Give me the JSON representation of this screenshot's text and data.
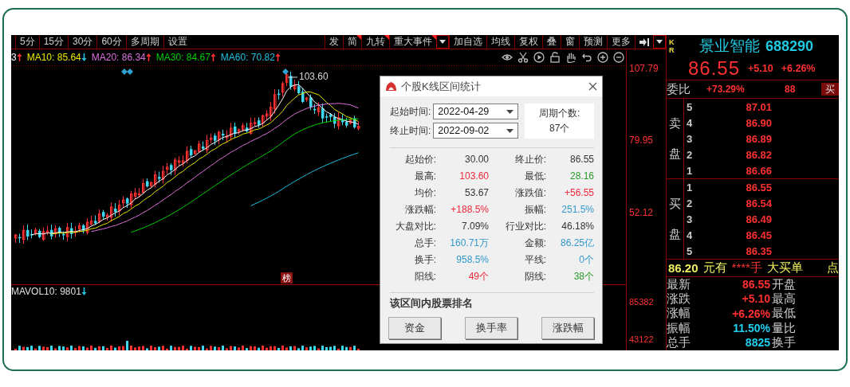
{
  "toolbar": {
    "left": [
      {
        "label": "5分"
      },
      {
        "label": "15分"
      },
      {
        "label": "30分"
      },
      {
        "label": "60分"
      },
      {
        "label": "多周期"
      },
      {
        "label": "设置"
      }
    ],
    "right": [
      {
        "kind": "text",
        "label": "发",
        "flag": false
      },
      {
        "kind": "text",
        "label": "简",
        "flag": true
      },
      {
        "kind": "text",
        "label": "九转",
        "flag": true
      },
      {
        "kind": "text",
        "label": "重大事件",
        "flag": true
      },
      {
        "kind": "dropdown"
      },
      {
        "kind": "text",
        "label": "加自选",
        "flag": false
      },
      {
        "kind": "text",
        "label": "均线",
        "flag": false
      },
      {
        "kind": "text",
        "label": "复权",
        "flag": false
      },
      {
        "kind": "text",
        "label": "叠",
        "flag": false
      },
      {
        "kind": "text",
        "label": "窗",
        "flag": false
      },
      {
        "kind": "text",
        "label": "预测",
        "flag": false
      },
      {
        "kind": "text",
        "label": "更多",
        "flag": false
      },
      {
        "kind": "icon"
      },
      {
        "kind": "dropdown"
      }
    ]
  },
  "chart": {
    "ma": [
      {
        "label": "3",
        "color": "#ffffff",
        "rising": true
      },
      {
        "label": "MA10: 85.64",
        "color": "#e8e800",
        "rising": false
      },
      {
        "label": "MA20: 86.34",
        "color": "#e070e0",
        "rising": true
      },
      {
        "label": "MA30: 84.67",
        "color": "#00d000",
        "rising": true
      },
      {
        "label": "MA60: 70.82",
        "color": "#20c0e0",
        "rising": true
      }
    ],
    "high_label": "103.60",
    "event_badge": "榜",
    "price_axis": [
      "107.79",
      "79.95",
      "52.12"
    ],
    "volume": {
      "label": "MAVOL10: 9801",
      "rising": false,
      "axis": [
        "85382",
        "43122"
      ]
    }
  },
  "dialog": {
    "title": "个股K线区间统计",
    "start": {
      "label": "起始时间:",
      "value": "2022-04-29"
    },
    "end": {
      "label": "终止时间:",
      "value": "2022-09-02"
    },
    "period": {
      "label": "周期个数:",
      "value": "87个"
    },
    "stats": [
      {
        "label": "起始价:",
        "value": "30.00",
        "color": "#333333"
      },
      {
        "label": "终止价:",
        "value": "86.55",
        "color": "#333333"
      },
      {
        "label": "最高:",
        "value": "103.60",
        "color": "#f0283c"
      },
      {
        "label": "最低:",
        "value": "28.16",
        "color": "#2a9a2a"
      },
      {
        "label": "均价:",
        "value": "53.67",
        "color": "#333333"
      },
      {
        "label": "涨跌值:",
        "value": "+56.55",
        "color": "#f0283c"
      },
      {
        "label": "涨跌幅:",
        "value": "+188.5%",
        "color": "#f0283c"
      },
      {
        "label": "振幅:",
        "value": "251.5%",
        "color": "#3399cc"
      },
      {
        "label": "大盘对比:",
        "value": "7.09%",
        "color": "#333333"
      },
      {
        "label": "行业对比:",
        "value": "46.18%",
        "color": "#333333"
      },
      {
        "label": "总手:",
        "value": "160.71万",
        "color": "#3399cc"
      },
      {
        "label": "金额:",
        "value": "86.25亿",
        "color": "#3399cc"
      },
      {
        "label": "换手:",
        "value": "958.5%",
        "color": "#3399cc"
      },
      {
        "label": "平线:",
        "value": "0个",
        "color": "#3399cc"
      },
      {
        "label": "阳线:",
        "value": "49个",
        "color": "#f0283c"
      },
      {
        "label": "阴线:",
        "value": "38个",
        "color": "#2a9a2a"
      }
    ],
    "ranking_title": "该区间内股票排名",
    "buttons": [
      "资金",
      "换手率",
      "涨跌幅"
    ]
  },
  "quote": {
    "badge": [
      "K",
      "R"
    ],
    "name": "景业智能",
    "code": "688290",
    "price": "86.55",
    "change": "+5.10",
    "change_pct": "+6.26%",
    "ratio": {
      "label": "委比",
      "value": "+73.29%",
      "diff": "88",
      "button": "买"
    },
    "asks_label": "卖盘",
    "asks": [
      {
        "level": "5",
        "price": "87.01"
      },
      {
        "level": "4",
        "price": "86.90"
      },
      {
        "level": "3",
        "price": "86.89"
      },
      {
        "level": "2",
        "price": "86.82"
      },
      {
        "level": "1",
        "price": "86.66"
      }
    ],
    "bids_label": "买盘",
    "bids": [
      {
        "level": "1",
        "price": "86.55"
      },
      {
        "level": "2",
        "price": "86.54"
      },
      {
        "level": "3",
        "price": "86.49"
      },
      {
        "level": "4",
        "price": "86.45"
      },
      {
        "level": "5",
        "price": "86.35"
      }
    ],
    "ticker": [
      {
        "text": "86.20",
        "alert": false
      },
      {
        "text": "元有",
        "alert": false
      },
      {
        "text": "****手",
        "alert": true
      },
      {
        "text": "大买单",
        "alert": false
      },
      {
        "text": "点",
        "alert": false
      }
    ],
    "stats": [
      {
        "label": "最新",
        "value": "86.55",
        "color": "#ff3030",
        "label2": "开盘"
      },
      {
        "label": "涨跌",
        "value": "+5.10",
        "color": "#ff3030",
        "label2": "最高"
      },
      {
        "label": "涨幅",
        "value": "+6.26%",
        "color": "#ff3030",
        "label2": "最低"
      },
      {
        "label": "振幅",
        "value": "11.50%",
        "color": "#20d0f0",
        "label2": "量比"
      },
      {
        "label": "总手",
        "value": "8825",
        "color": "#20d0f0",
        "label2": "换手"
      }
    ]
  }
}
